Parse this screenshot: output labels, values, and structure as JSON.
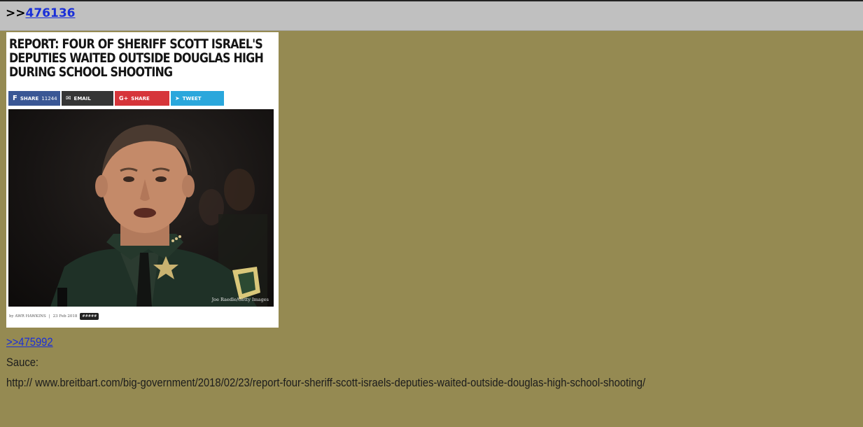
{
  "post": {
    "reply_prefix": ">>",
    "reply_link": "476136",
    "quote_link": ">>475992",
    "label": "Sauce:",
    "url": "http:// www.breitbart.com/big-government/2018/02/23/report-four-sheriff-scott-israels-deputies-waited-outside-douglas-high-school-shooting/"
  },
  "image": {
    "headline": "REPORT: FOUR OF SHERIFF SCOTT ISRAEL'S DEPUTIES WAITED OUTSIDE DOUGLAS HIGH DURING SCHOOL SHOOTING",
    "share_facebook": "Share",
    "share_facebook_count": "11244",
    "share_email": "Email",
    "share_gplus": "Share",
    "share_tweet": "Tweet",
    "photo_credit": "Joe Raedle/Getty Images",
    "byline": "by AWR HAWKINS",
    "date": "23 Feb 2018",
    "comments_tag": "#####"
  },
  "colors": {
    "background": "#958a52",
    "header": "#c0c0c0",
    "link": "#1a2fd8"
  }
}
